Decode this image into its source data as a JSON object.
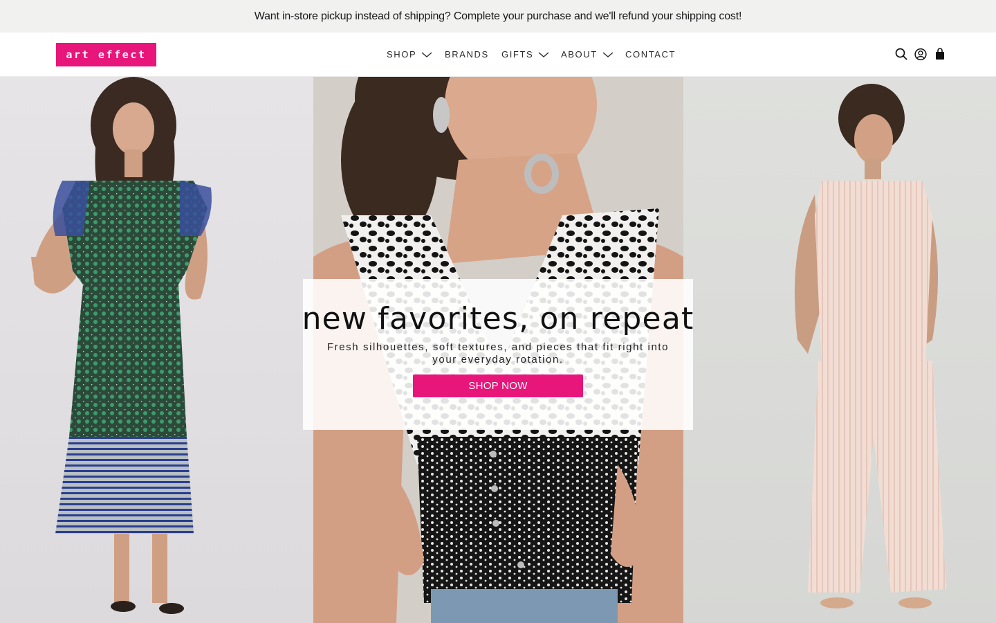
{
  "announcement": {
    "text": "Want in-store pickup instead of shipping? Complete your purchase and we'll refund your shipping cost!"
  },
  "header": {
    "logo_text": "art effect",
    "nav": [
      {
        "label": "SHOP",
        "has_dropdown": true
      },
      {
        "label": "BRANDS",
        "has_dropdown": false
      },
      {
        "label": "GIFTS",
        "has_dropdown": true
      },
      {
        "label": "ABOUT",
        "has_dropdown": true
      },
      {
        "label": "CONTACT",
        "has_dropdown": false
      }
    ],
    "icons": [
      "search-icon",
      "account-icon",
      "cart-icon"
    ]
  },
  "hero": {
    "title": "new favorites, on repeat",
    "subtitle": "Fresh silhouettes, soft textures, and pieces that fit right into your everyday rotation.",
    "cta_label": "SHOP NOW"
  },
  "colors": {
    "brand": "#e8157a",
    "announcement_bg": "#f1f1f0",
    "text": "#1a1a1a"
  }
}
